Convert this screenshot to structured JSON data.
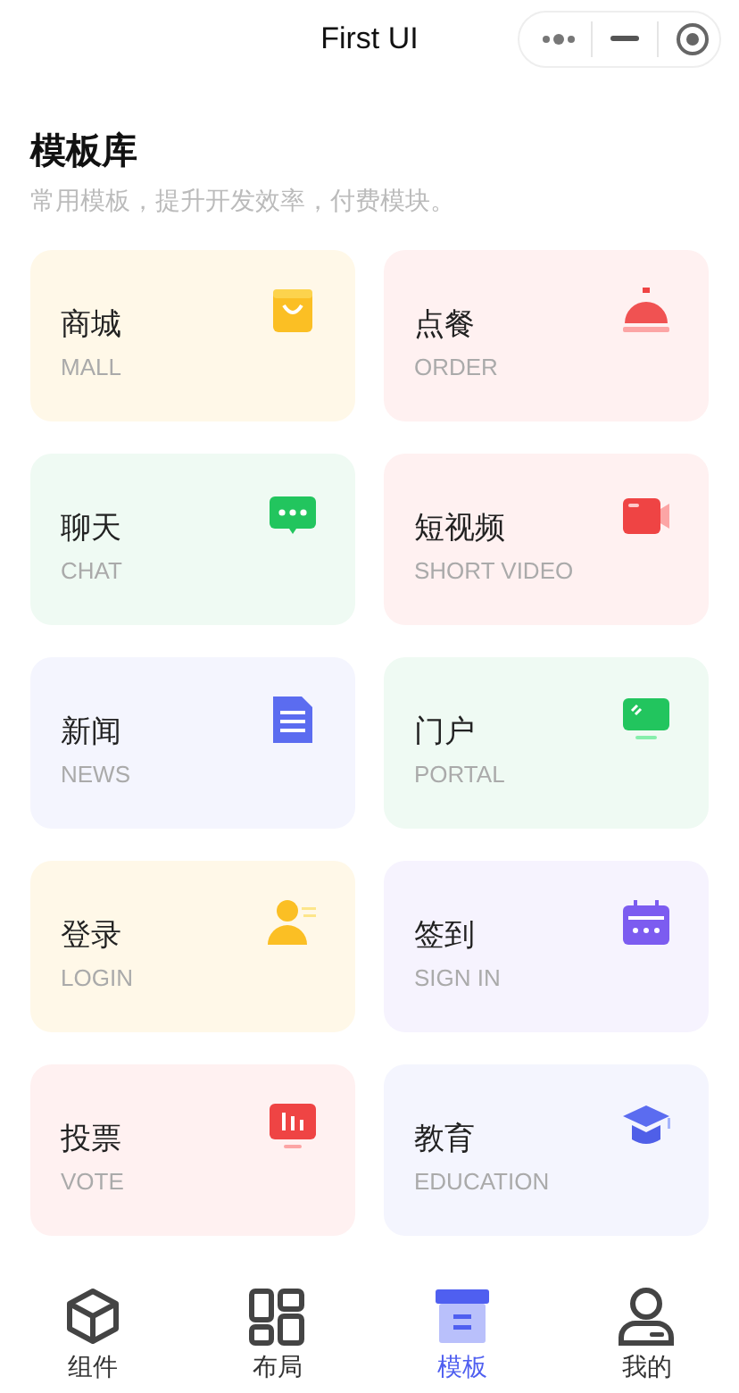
{
  "nav_bar": {
    "title": "First UI"
  },
  "header": {
    "title": "模板库",
    "subtitle": "常用模板，提升开发效率，付费模块。"
  },
  "cards": [
    {
      "title": "商城",
      "subtitle": "MALL",
      "kind": "bag",
      "color": "#fff8e8"
    },
    {
      "title": "点餐",
      "subtitle": "ORDER",
      "kind": "bell",
      "color": "#fff1f1"
    },
    {
      "title": "聊天",
      "subtitle": "CHAT",
      "kind": "chat",
      "color": "#effaf3"
    },
    {
      "title": "短视频",
      "subtitle": "SHORT VIDEO",
      "kind": "video",
      "color": "#fff1f1"
    },
    {
      "title": "新闻",
      "subtitle": "NEWS",
      "kind": "doc",
      "color": "#f4f5fe"
    },
    {
      "title": "门户",
      "subtitle": "PORTAL",
      "kind": "monitor",
      "color": "#effaf3"
    },
    {
      "title": "登录",
      "subtitle": "LOGIN",
      "kind": "user",
      "color": "#fff8e8"
    },
    {
      "title": "签到",
      "subtitle": "SIGN IN",
      "kind": "calendar",
      "color": "#f6f3fe"
    },
    {
      "title": "投票",
      "subtitle": "VOTE",
      "kind": "chart",
      "color": "#fff1f1"
    },
    {
      "title": "教育",
      "subtitle": "EDUCATION",
      "kind": "cap",
      "color": "#f4f5fe"
    }
  ],
  "tab_bar": [
    {
      "label": "组件",
      "kind": "cube",
      "selected": false
    },
    {
      "label": "布局",
      "kind": "grid",
      "selected": false
    },
    {
      "label": "模板",
      "kind": "box",
      "selected": true
    },
    {
      "label": "我的",
      "kind": "person",
      "selected": false
    }
  ]
}
